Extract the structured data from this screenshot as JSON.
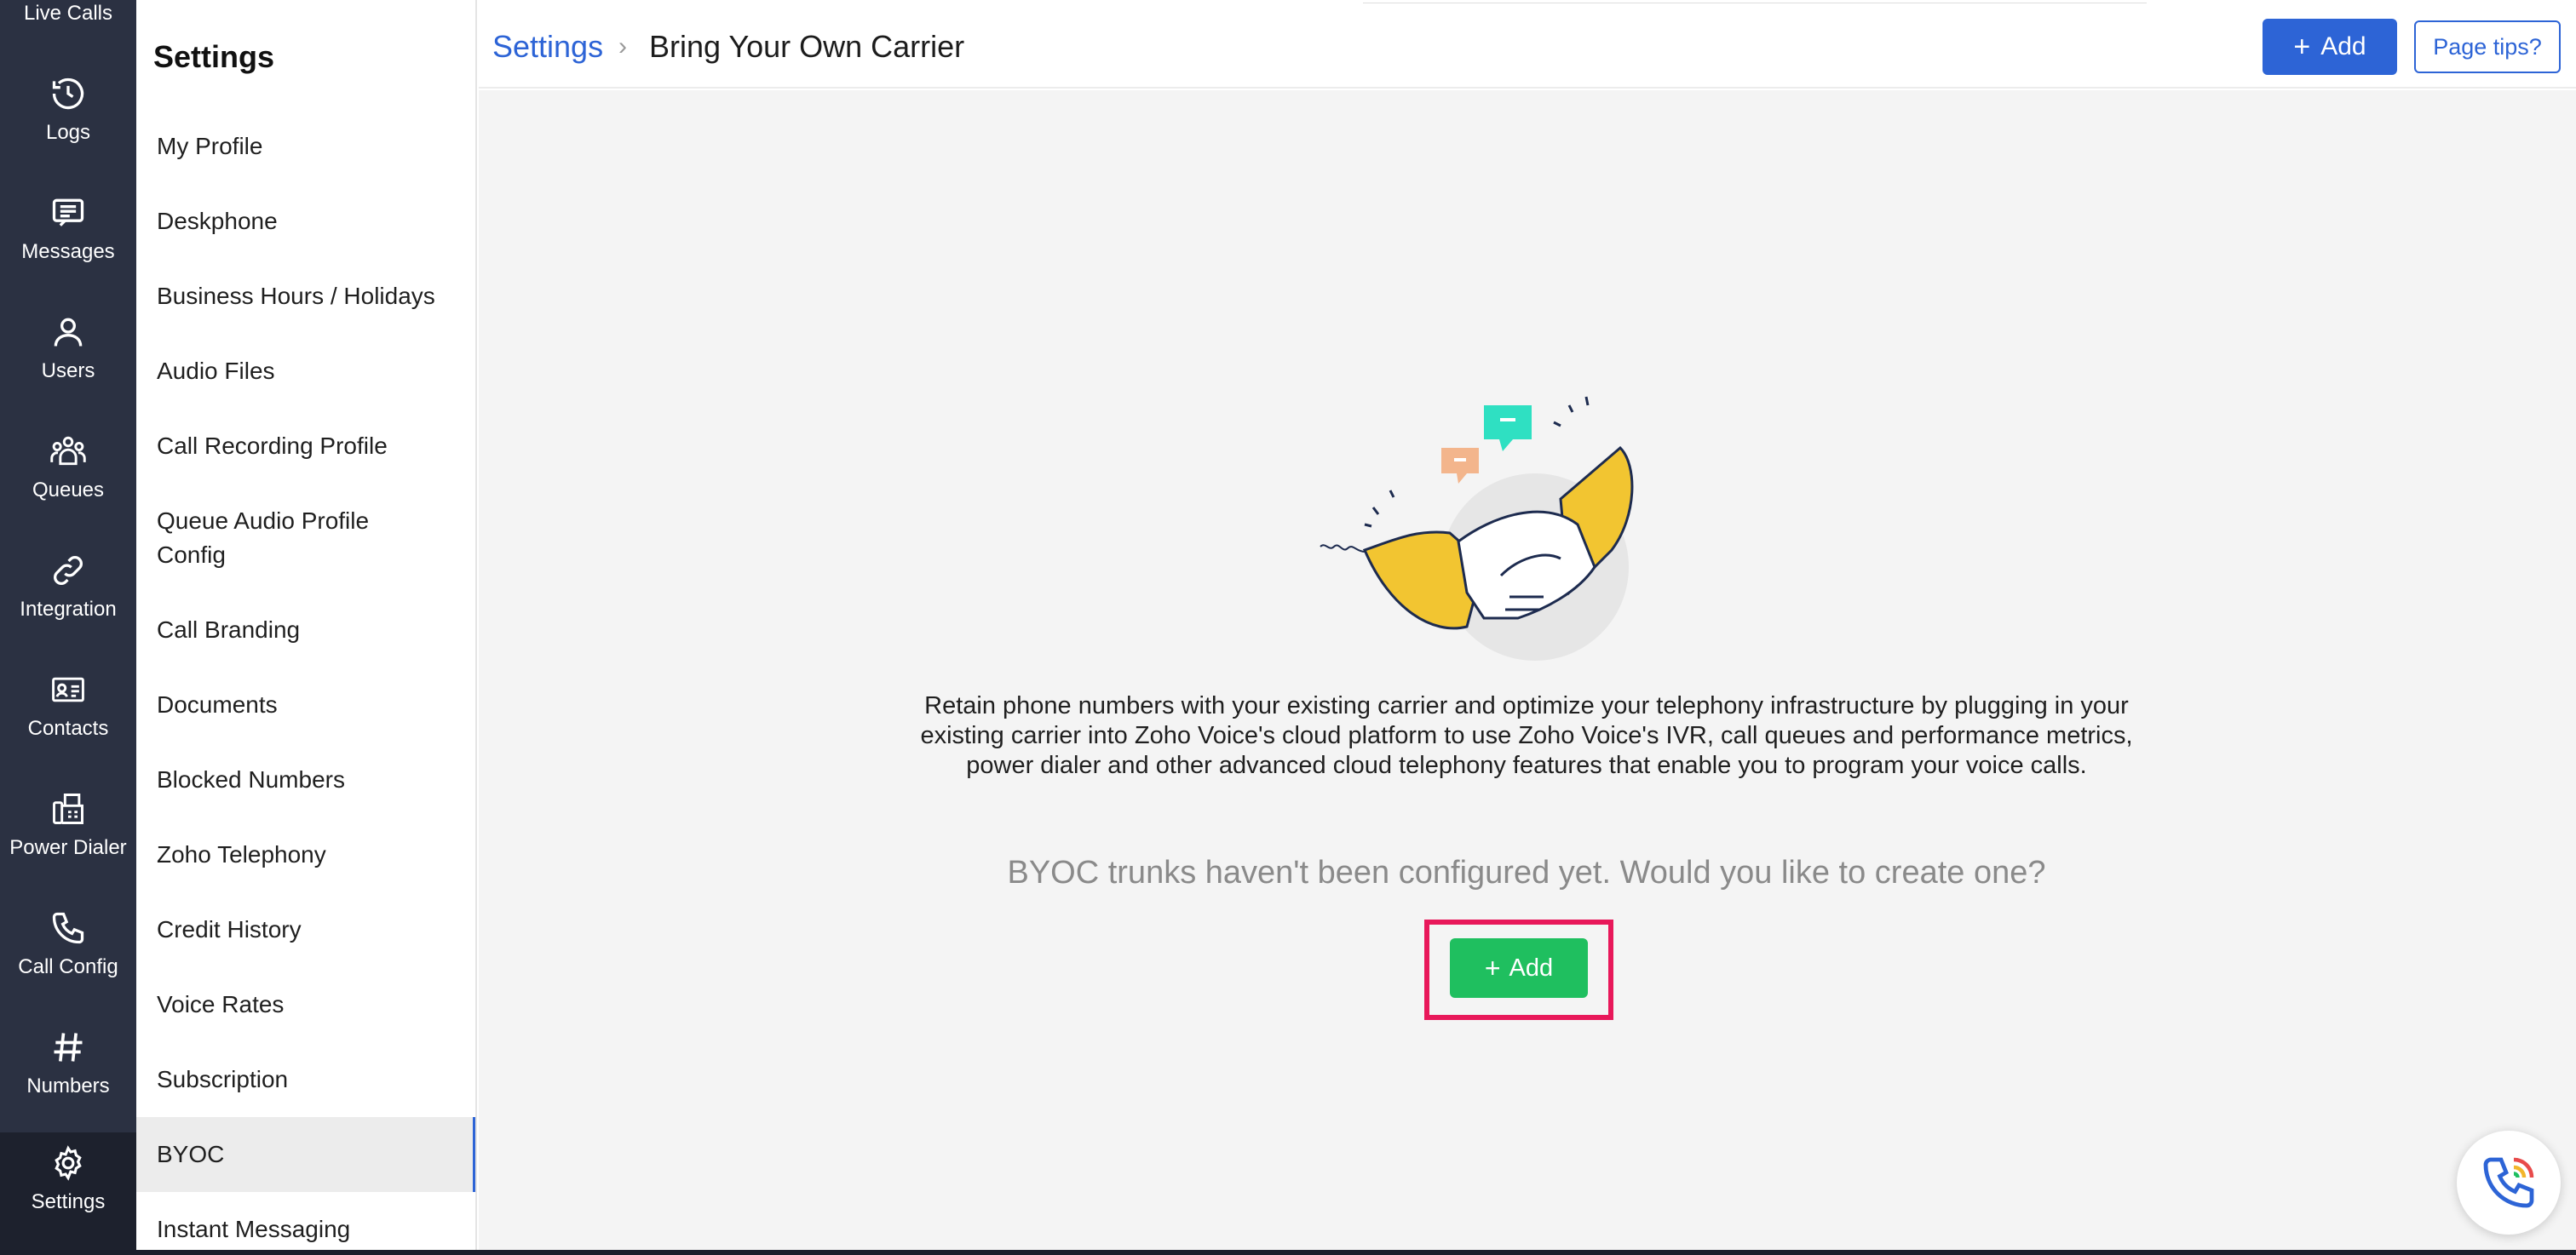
{
  "rail": {
    "top_label": "Live Calls",
    "items": [
      {
        "label": "Logs",
        "icon": "history-icon"
      },
      {
        "label": "Messages",
        "icon": "message-icon"
      },
      {
        "label": "Users",
        "icon": "user-icon"
      },
      {
        "label": "Queues",
        "icon": "queues-icon"
      },
      {
        "label": "Integration",
        "icon": "link-icon"
      },
      {
        "label": "Contacts",
        "icon": "contact-card-icon"
      },
      {
        "label": "Power Dialer",
        "icon": "fax-icon"
      },
      {
        "label": "Call Config",
        "icon": "phone-icon"
      },
      {
        "label": "Numbers",
        "icon": "hash-icon"
      },
      {
        "label": "Settings",
        "icon": "gear-icon"
      }
    ]
  },
  "sidebar": {
    "title": "Settings",
    "items": [
      {
        "label": "My Profile"
      },
      {
        "label": "Deskphone"
      },
      {
        "label": "Business Hours / Holidays"
      },
      {
        "label": "Audio Files"
      },
      {
        "label": "Call Recording Profile"
      },
      {
        "label": "Queue Audio Profile Config"
      },
      {
        "label": "Call Branding"
      },
      {
        "label": "Documents"
      },
      {
        "label": "Blocked Numbers"
      },
      {
        "label": "Zoho Telephony"
      },
      {
        "label": "Credit History"
      },
      {
        "label": "Voice Rates"
      },
      {
        "label": "Subscription"
      },
      {
        "label": "BYOC"
      },
      {
        "label": "Instant Messaging"
      }
    ],
    "active": "BYOC"
  },
  "header": {
    "breadcrumb_root": "Settings",
    "breadcrumb_sep": "›",
    "page_title": "Bring Your Own Carrier",
    "add_label": "Add",
    "tips_label": "Page tips?"
  },
  "main": {
    "description": "Retain phone numbers with your existing carrier and optimize your telephony infrastructure by plugging in your existing carrier into Zoho Voice's cloud platform to use Zoho Voice's IVR, call queues and performance metrics, power dialer and other advanced cloud telephony features that enable you to program your voice calls.",
    "empty_message": "BYOC trunks haven't been configured yet. Would you like to create one?",
    "add_label": "Add"
  },
  "colors": {
    "rail_bg": "#2b3142",
    "primary": "#2d64d6",
    "success": "#1fbf5f",
    "highlight": "#e8185a"
  }
}
